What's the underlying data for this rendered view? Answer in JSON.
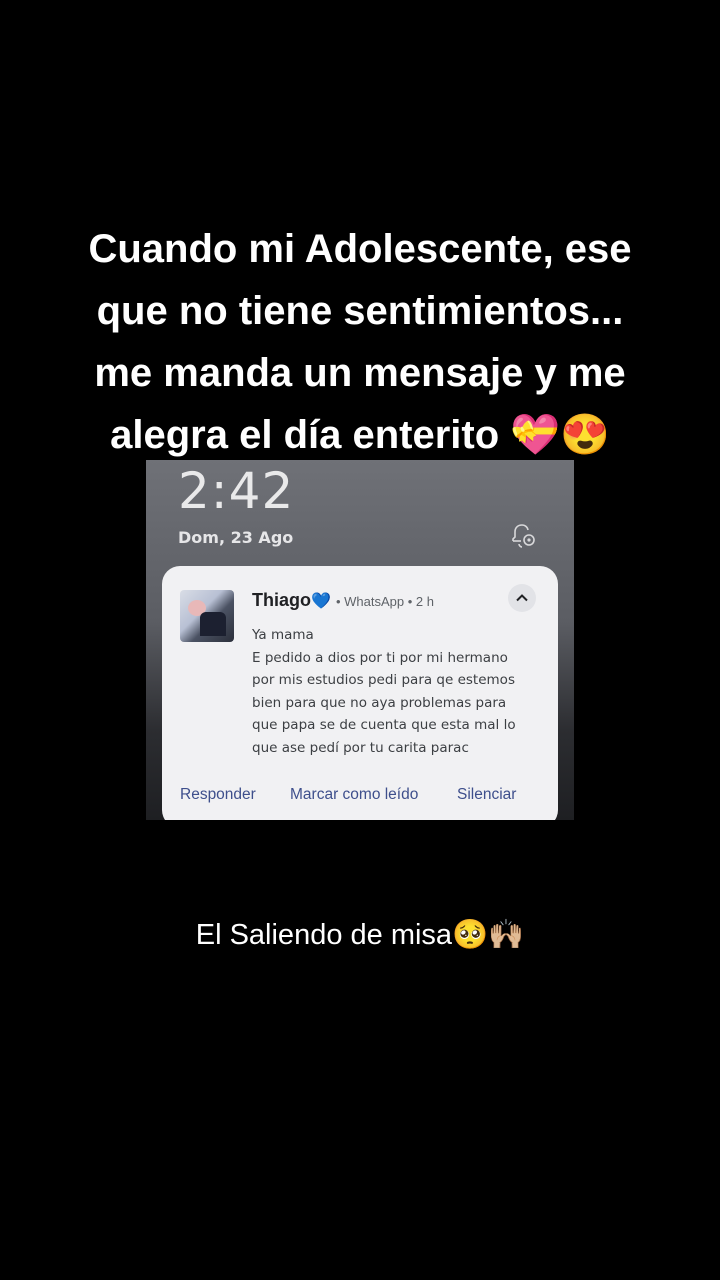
{
  "caption": {
    "line1": "Cuando mi Adolescente, ese",
    "line2": "que no tiene sentimientos...",
    "line3": "me manda un mensaje y me",
    "line4": "alegra el día enterito 💝😍"
  },
  "lockscreen": {
    "time": "2:42",
    "date": "Dom, 23 Ago",
    "icon": "bell-settings-icon"
  },
  "notification": {
    "sender": "Thiago",
    "sender_emoji": "💙",
    "meta": "• WhatsApp • 2 h",
    "collapse_icon": "chevron-up-icon",
    "message_lines": [
      "Ya mama",
      "E pedido a dios por ti por mi hermano",
      "por mis estudios pedi para qe estemos",
      "bien  para que no aya problemas para",
      "que papa se de cuenta que esta mal lo",
      "que ase pedí por tu carita parac"
    ],
    "actions": {
      "reply": "Responder",
      "mark_read": "Marcar como leído",
      "mute": "Silenciar"
    }
  },
  "footer": {
    "text": "El Saliendo de misa🥺🙌🏼"
  }
}
